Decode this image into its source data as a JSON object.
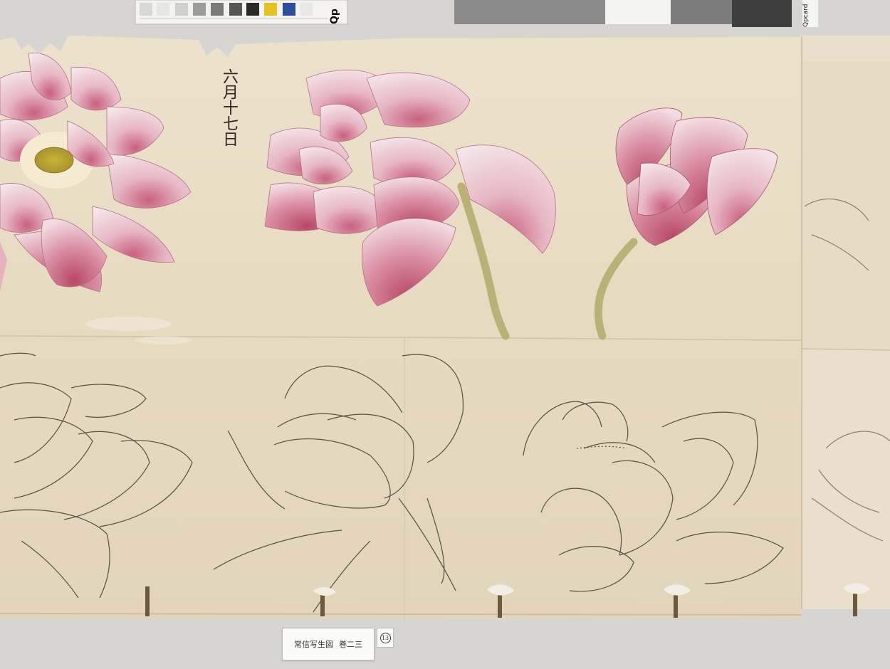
{
  "artwork": {
    "inscription": "六月十七日",
    "catalog_label": {
      "title": "常信写生図",
      "volume": "巻二三"
    },
    "page_number": "13"
  },
  "color_target": {
    "ruler_brand": "Qp",
    "chart_brand": "Qpcard"
  },
  "colors": {
    "paper": "#e8dcc4",
    "petal_pink": "#d88fa4",
    "petal_light": "#f1dde2",
    "stem": "#b7b27a",
    "ink": "#4a4038",
    "background": "#d6d5d2"
  }
}
